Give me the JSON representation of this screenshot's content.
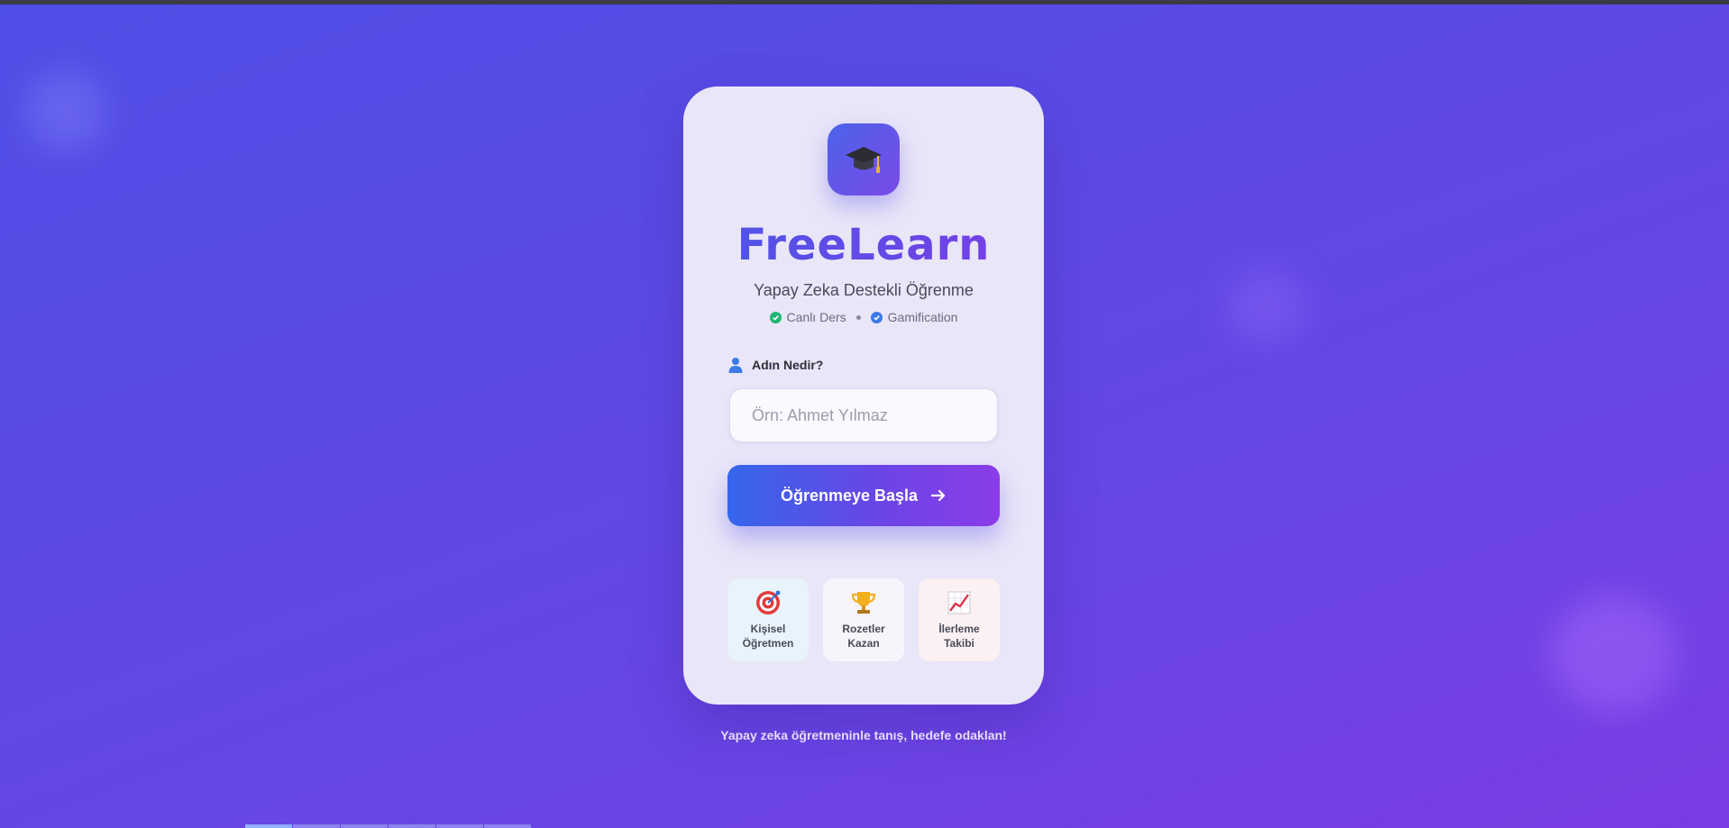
{
  "app": {
    "brand_name": "FreeLearn",
    "subtitle": "Yapay Zeka Destekli Öğrenme",
    "badges": [
      {
        "label": "Canlı Ders",
        "icon": "check-circle-icon",
        "color": "#22b573"
      },
      {
        "label": "Gamification",
        "icon": "check-circle-icon",
        "color": "#3a7be8"
      }
    ],
    "logo_icon": "graduation-cap-icon"
  },
  "form": {
    "name_label": "Adın Nedir?",
    "name_placeholder": "Örn: Ahmet Yılmaz",
    "name_value": "",
    "submit_label": "Öğrenmeye Başla"
  },
  "features": [
    {
      "label": "Kişisel Öğretmen",
      "icon": "target-icon"
    },
    {
      "label": "Rozetler Kazan",
      "icon": "trophy-icon"
    },
    {
      "label": "İlerleme Takibi",
      "icon": "chart-up-icon"
    }
  ],
  "footer": {
    "tagline": "Yapay zeka öğretmeninle tanış, hedefe odaklan!"
  },
  "colors": {
    "background_start": "#4f4ee6",
    "background_end": "#7a3ce4",
    "accent_blue": "#3566ec",
    "accent_purple": "#8b3ce8"
  }
}
